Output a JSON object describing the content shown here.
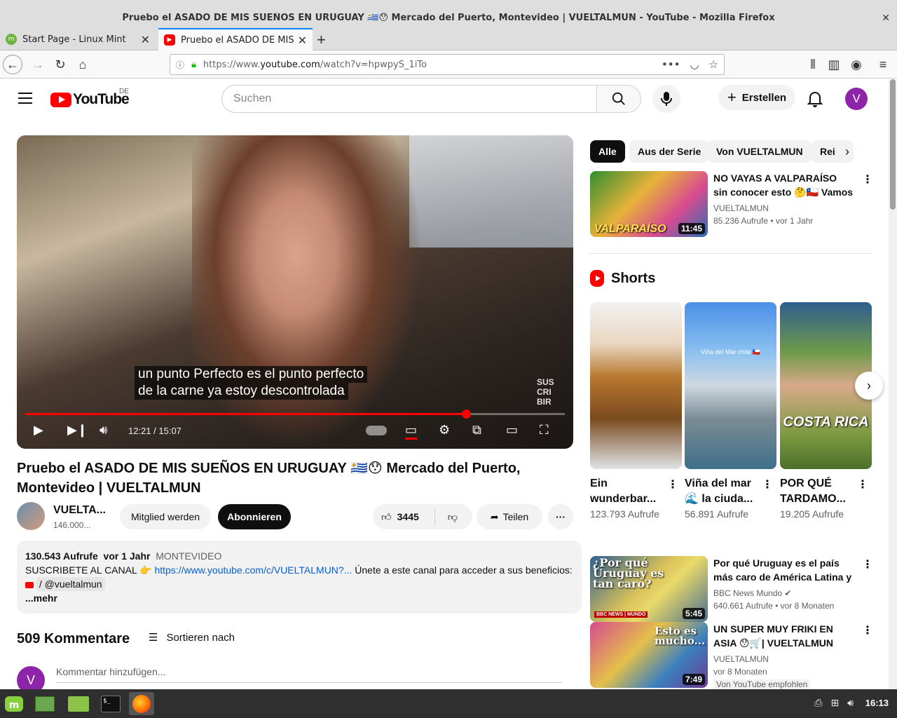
{
  "window": {
    "title": "Pruebo el ASADO DE MIS SUEÑOS EN URUGUAY 🇺🇾😯 Mercado del Puerto, Montevideo | VUELTALMUN - YouTube - Mozilla Firefox"
  },
  "tabs": [
    {
      "label": "Start Page - Linux Mint",
      "active": false
    },
    {
      "label": "Pruebo el ASADO DE MIS SUEÑOS",
      "active": true
    }
  ],
  "url": {
    "scheme": "https://www.",
    "host": "youtube.com",
    "path": "/watch?v=hpwpyS_1iTo"
  },
  "masthead": {
    "logo_word": "YouTube",
    "country_code": "DE",
    "search_placeholder": "Suchen",
    "create_label": "Erstellen",
    "avatar_letter": "V"
  },
  "player": {
    "subtitle_line1": "un punto Perfecto es el punto perfecto",
    "subtitle_line2": "de la carne ya estoy descontrolada",
    "time": "12:21 / 15:07",
    "progress": 0.817,
    "watermark": "SUS CRI BIR"
  },
  "video": {
    "title": "Pruebo el ASADO DE MIS SUEÑOS EN URUGUAY 🇺🇾😯 Mercado del Puerto, Montevideo | VUELTALMUN",
    "channel": "VUELTA...",
    "subscribers": "146.000...",
    "member_label": "Mitglied werden",
    "subscribe_label": "Abonnieren",
    "likes": "3445",
    "share_label": "Teilen"
  },
  "description": {
    "views": "130.543 Aufrufe",
    "date": "vor 1 Jahr",
    "location": "MONTEVIDEO",
    "text_before": "SUSCRIBETE AL CANAL 👉 ",
    "link": "https://www.youtube.com/c/VUELTALMUN?...",
    "text_after": " Únete a este canal para acceder a sus beneficios:",
    "handle": "/ @vueltalmun",
    "more": "...mehr"
  },
  "comments": {
    "count_label": "509 Kommentare",
    "sort_label": "Sortieren nach",
    "input_placeholder": "Kommentar hinzufügen...",
    "avatar_letter": "V"
  },
  "chips": [
    "Alle",
    "Aus der Serie",
    "Von VUELTALMUN",
    "Rei"
  ],
  "recommendations": [
    {
      "title": "NO VAYAS A VALPARAÍSO sin conocer esto 🤔🇨🇱 Vamos del...",
      "channel": "VUELTALMUN",
      "meta": "85.236 Aufrufe  • vor 1 Jahr",
      "duration": "11:45",
      "thumb_text": "VALPARAÍSO"
    },
    {
      "title": "Por qué Uruguay es el país más caro de América Latina y uno ...",
      "channel": "BBC News Mundo",
      "meta": "640.661 Aufrufe  • vor 8 Monaten",
      "duration": "5:45",
      "thumb_text": "¿Por qué Uruguay es tan caro?",
      "thumb_badge": "BBC NEWS | MUNDO"
    },
    {
      "title": "UN SUPER MUY FRIKI EN ASIA 😯🛒| VUELTALMUN",
      "channel": "VUELTALMUN",
      "meta": "vor 8 Monaten",
      "duration": "7:49",
      "thumb_text": "Esto es mucho...",
      "badge": "Von YouTube empfohlen"
    }
  ],
  "shorts": {
    "heading": "Shorts",
    "items": [
      {
        "title": "Ein wunderbar...",
        "views": "123.793 Aufrufe"
      },
      {
        "title": "Viña del mar 🌊 la ciuda...",
        "views": "56.891 Aufrufe",
        "overlay": "Viña del Mar chile 🇨🇱"
      },
      {
        "title": "POR QUÉ TARDAMO...",
        "views": "19.205 Aufrufe",
        "overlay": "COSTA RICA"
      }
    ]
  },
  "taskbar": {
    "clock": "16:13"
  }
}
